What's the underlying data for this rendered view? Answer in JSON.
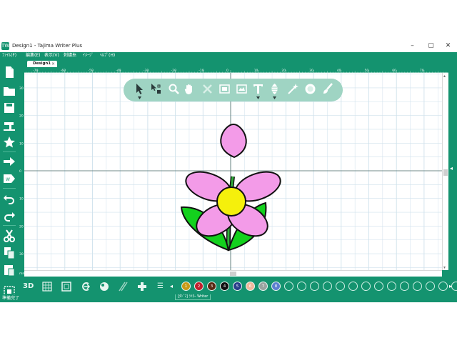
{
  "window": {
    "title": "Design1 - Tajima Writer Plus",
    "app_icon": "tw-logo-icon",
    "minimize": "–",
    "maximize": "▢",
    "close": "✕"
  },
  "menubar": {
    "items": [
      "ﾌｧｲﾙ(F)",
      "編集(E)",
      "表示(V)",
      "刺繍糸",
      "ｲﾒｰｼﾞ",
      "ﾍﾙﾌﾟ(H)"
    ]
  },
  "tab": {
    "label": "Design1",
    "close": "×"
  },
  "ruler": {
    "h_labels": [
      "-70",
      "-60",
      "-50",
      "-40",
      "-30",
      "-20",
      "-10",
      "0",
      "10",
      "20",
      "30",
      "40",
      "50",
      "60",
      "70"
    ],
    "v_labels": [
      "30",
      "20",
      "10",
      "0",
      "10",
      "20",
      "30"
    ],
    "unit": "mm"
  },
  "floating_toolbar": {
    "tools": [
      "pointer-icon",
      "node-edit-icon",
      "zoom-icon",
      "pan-hand-icon",
      "delete-x-icon",
      "frame-fit-icon",
      "image-icon",
      "text-tool-icon",
      "stitch-fill-icon",
      "magic-wand-icon",
      "ball-icon",
      "brush-icon"
    ]
  },
  "bottom": {
    "threed_label": "3D",
    "swatches": [
      {
        "num": "1",
        "color": "#c79a16"
      },
      {
        "num": "2",
        "color": "#c0202e"
      },
      {
        "num": "3",
        "color": "#5a2a14"
      },
      {
        "num": "4",
        "color": "#111111"
      },
      {
        "num": "5",
        "color": "#2a3f8a"
      },
      {
        "num": "6",
        "color": "#f2b89c"
      },
      {
        "num": "7",
        "color": "#9aa3a0"
      },
      {
        "num": "8",
        "color": "#5c7fd0"
      }
    ],
    "empty_swatches": 14
  },
  "status": {
    "left": "準備完了",
    "mid": "[ﾀｼﾞﾏ] ﾗｲﾀｰ Writer"
  },
  "colors": {
    "brand": "#14936f",
    "petal": "#f39be8",
    "center": "#f5f00c",
    "leaf": "#13d11d",
    "stem": "#2fae3a",
    "grid": "#cfe1ec"
  }
}
